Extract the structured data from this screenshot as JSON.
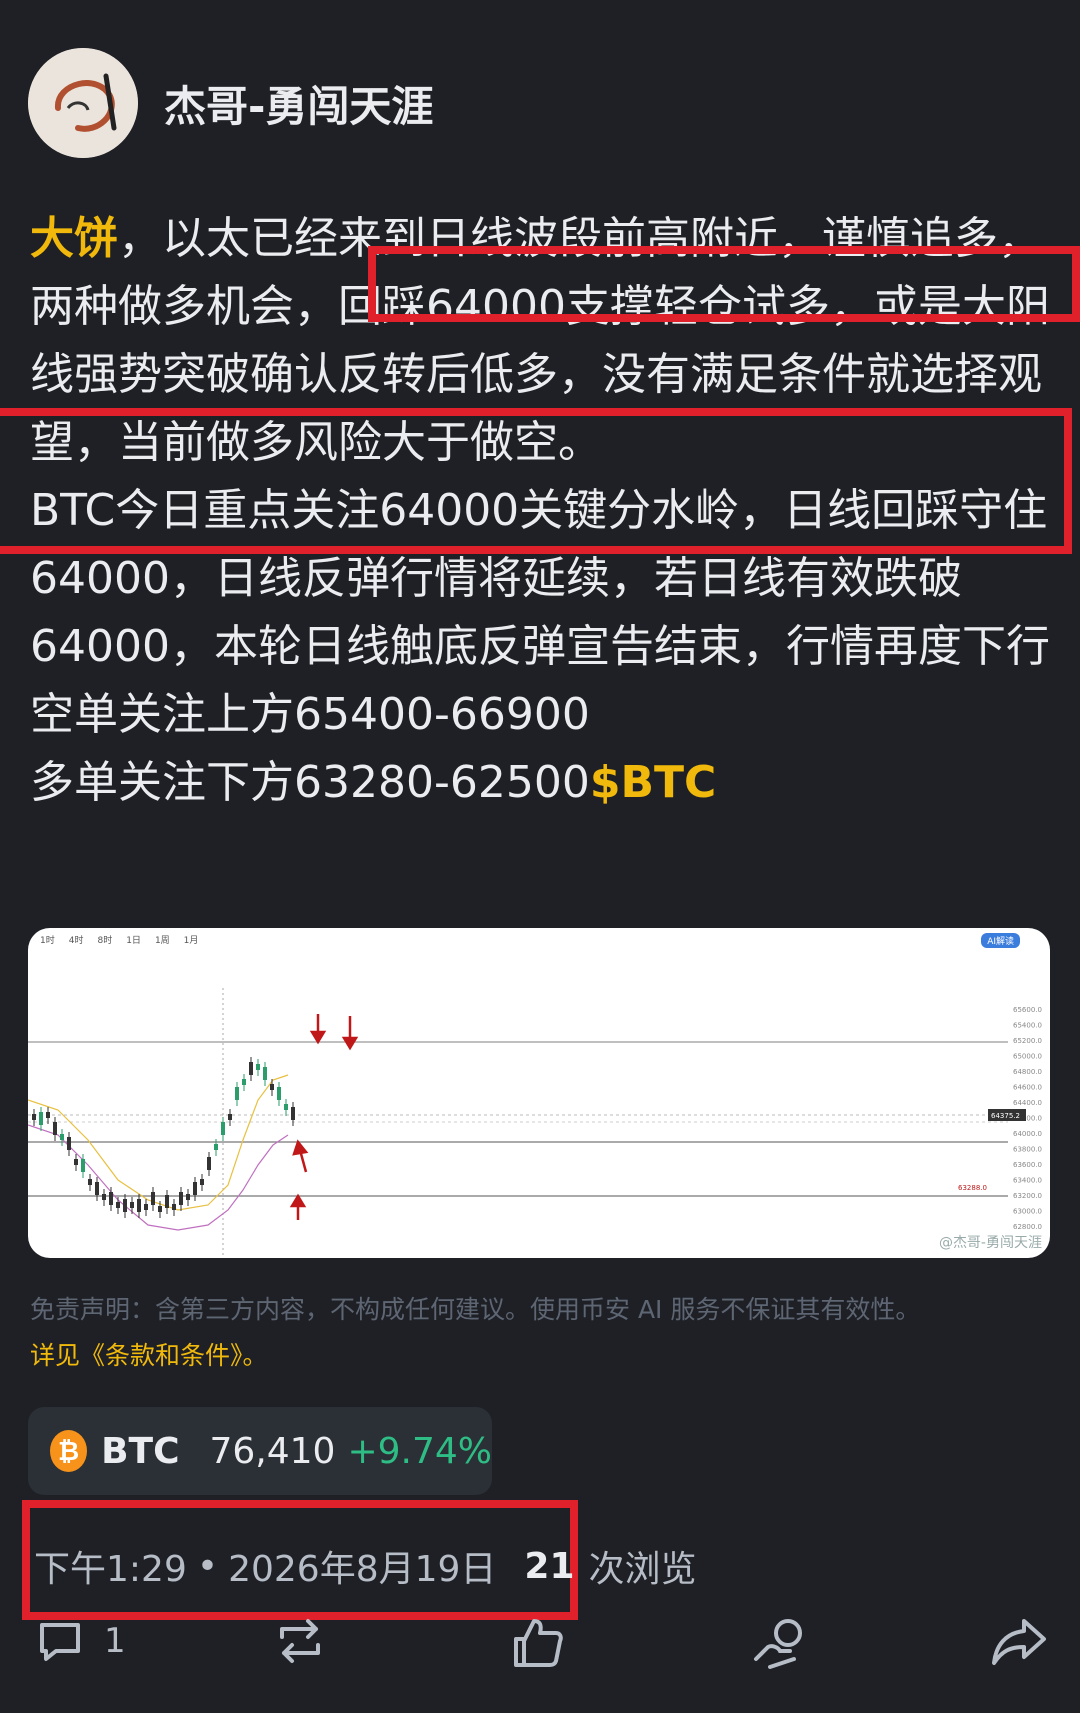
{
  "author": {
    "name": "杰哥-勇闯天涯"
  },
  "post": {
    "tag": "大饼",
    "p1_rest": "，以太已经来到日线波段前高附近，谨慎追多，两种做多机会，回踩64000支撑轻仓试多，或是大阳线强势突破确认反转后低多，没有满足条件就选择观望，当前做多风险大于做空。",
    "p2": "BTC今日重点关注64000关键分水岭，日线回踩守住64000，日线反弹行情将延续，若日线有效跌破64000，本轮日线触底反弹宣告结束，行情再度下行",
    "p3": "空单关注上方65400-66900",
    "p4": "多单关注下方63280-62500",
    "cashtag": "$BTC"
  },
  "chart": {
    "toolbar": [
      "1时",
      "4时",
      "8时",
      "1日",
      "1周",
      "1月"
    ],
    "ai_label": "AI解读",
    "price_labels": [
      "65600.0",
      "65400.0",
      "65200.0",
      "65000.0",
      "64800.0",
      "64600.0",
      "64400.0",
      "64200.0",
      "64000.0",
      "63800.0",
      "63600.0",
      "63400.0",
      "63200.0",
      "63000.0",
      "62800.0"
    ],
    "current_price": "64375.2",
    "marker_price": "63288.0",
    "watermark": "@杰哥-勇闯天涯"
  },
  "disclaimer": {
    "text": "免责声明：含第三方内容，不构成任何建议。使用币安 AI 服务不保证其有效性。",
    "terms": "详见《条款和条件》。"
  },
  "ticker": {
    "symbol": "BTC",
    "price": "76,410",
    "change": "+9.74%"
  },
  "meta": {
    "time": "下午1:29",
    "sep": "•",
    "date": "2026年8月19日",
    "views": "21",
    "views_label": "次浏览"
  },
  "actions": {
    "comment_count": "1"
  },
  "colors": {
    "accent": "#f0b90b",
    "up": "#2ebd85",
    "highlight": "#e0202a"
  }
}
